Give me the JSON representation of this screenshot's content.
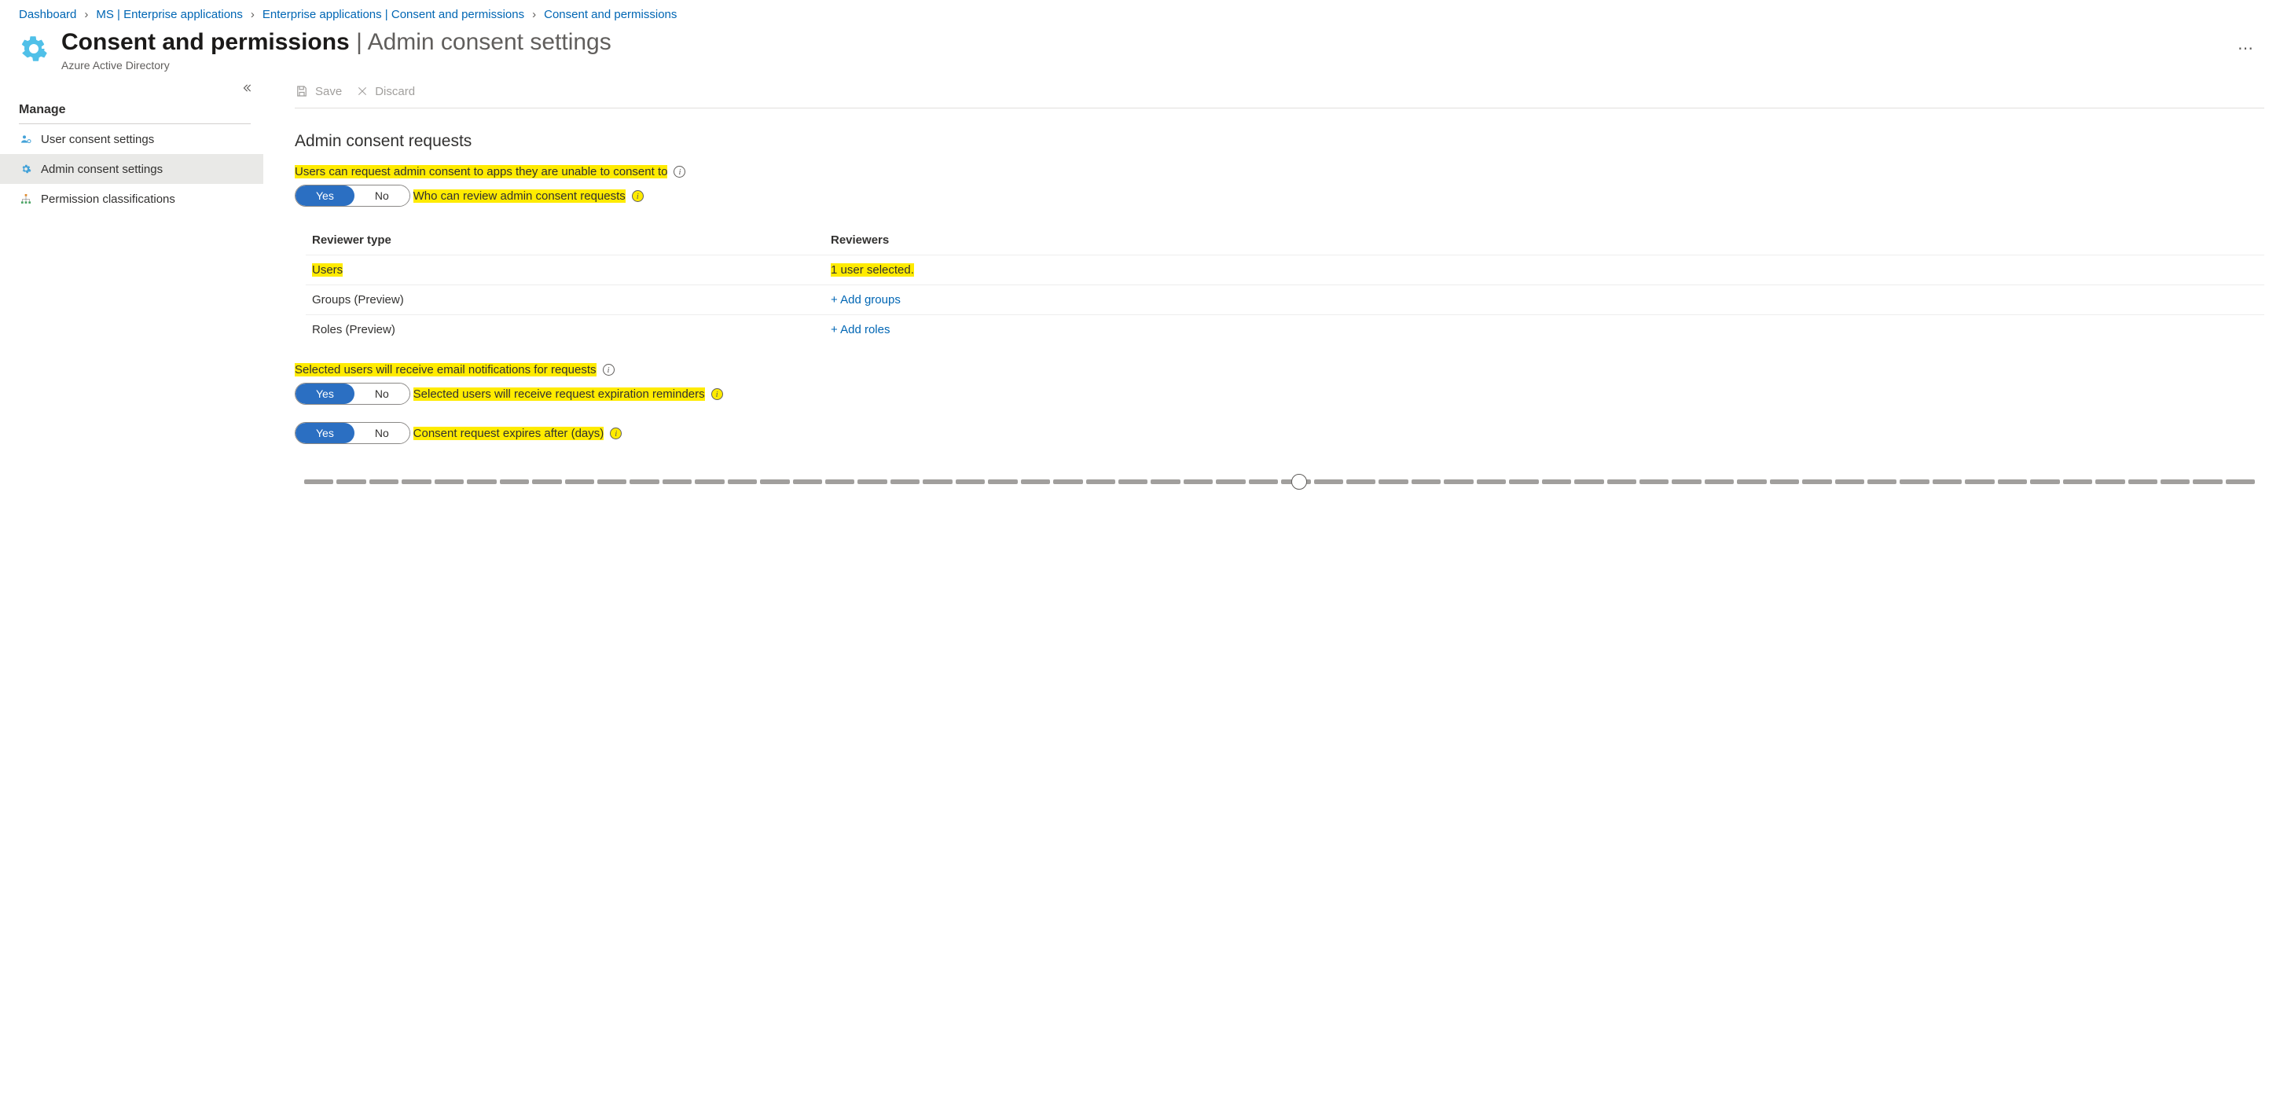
{
  "breadcrumb": [
    {
      "label": "Dashboard"
    },
    {
      "label": "MS | Enterprise applications"
    },
    {
      "label": "Enterprise applications | Consent and permissions"
    },
    {
      "label": "Consent and permissions"
    }
  ],
  "header": {
    "title_strong": "Consent and permissions",
    "title_sep": " | ",
    "title_sub": "Admin consent settings",
    "product": "Azure Active Directory"
  },
  "sidebar": {
    "group": "Manage",
    "items": [
      {
        "label": "User consent settings",
        "icon": "people-gear-icon",
        "active": false
      },
      {
        "label": "Admin consent settings",
        "icon": "gear-icon",
        "active": true
      },
      {
        "label": "Permission classifications",
        "icon": "hierarchy-icon",
        "active": false
      }
    ]
  },
  "toolbar": {
    "save_label": "Save",
    "discard_label": "Discard"
  },
  "content": {
    "section_title": "Admin consent requests",
    "q1": {
      "label": "Users can request admin consent to apps they are unable to consent to",
      "yes": "Yes",
      "no": "No",
      "value": "Yes"
    },
    "q2": {
      "label": "Who can review admin consent requests",
      "col_type": "Reviewer type",
      "col_rev": "Reviewers",
      "rows": [
        {
          "type": "Users",
          "reviewers": "1 user selected.",
          "highlight": true,
          "link": false
        },
        {
          "type": "Groups (Preview)",
          "reviewers": "+ Add groups",
          "highlight": false,
          "link": true
        },
        {
          "type": "Roles (Preview)",
          "reviewers": "+ Add roles",
          "highlight": false,
          "link": true
        }
      ]
    },
    "q3": {
      "label": "Selected users will receive email notifications for requests",
      "yes": "Yes",
      "no": "No",
      "value": "Yes"
    },
    "q4": {
      "label": "Selected users will receive request expiration reminders",
      "yes": "Yes",
      "no": "No",
      "value": "Yes"
    },
    "q5": {
      "label": "Consent request expires after (days)",
      "segments": 60,
      "value_pct": 51
    }
  }
}
